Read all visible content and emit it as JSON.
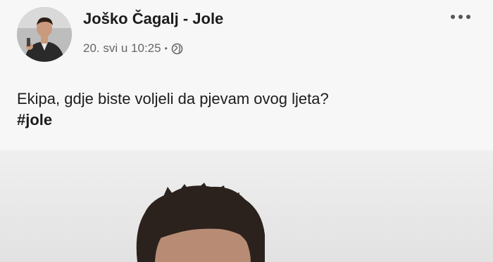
{
  "post": {
    "author": "Joško Čagalj - Jole",
    "date": "20. svi u 10:25",
    "separator": "•",
    "privacy_icon": "globe-icon",
    "more_icon": "more-dots-icon",
    "text": "Ekipa, gdje biste voljeli da pjevam ovog ljeta?",
    "hashtag": "#jole"
  }
}
